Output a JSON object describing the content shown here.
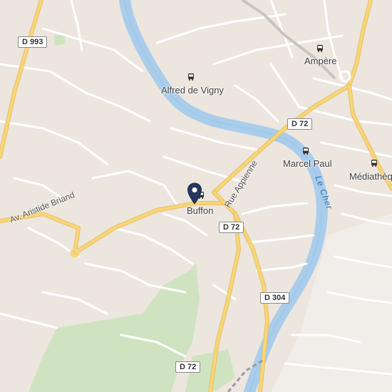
{
  "map": {
    "places": [
      {
        "key": "alfred",
        "label": "Alfred de Vigny"
      },
      {
        "key": "ampere",
        "label": "Ampère"
      },
      {
        "key": "marcel",
        "label": "Marcel Paul"
      },
      {
        "key": "mediatheque",
        "label": "Médiathèq"
      },
      {
        "key": "buffon",
        "label": "Buffon"
      }
    ],
    "road_shields": [
      "D 993",
      "D 72",
      "D 72",
      "D 304",
      "D 72"
    ],
    "street_names": [
      "Av. Aristide Briand",
      "Rue Appienne"
    ],
    "river_name": "Le Cher",
    "icons": [
      "bus-stop-icon",
      "location-pin-icon"
    ],
    "colors": {
      "background": "#ece6df",
      "water": "#a9cdeb",
      "park": "#cfe3c0",
      "major_road": "#f7d57a",
      "minor_road": "#ffffff",
      "pin": "#26375e"
    }
  }
}
